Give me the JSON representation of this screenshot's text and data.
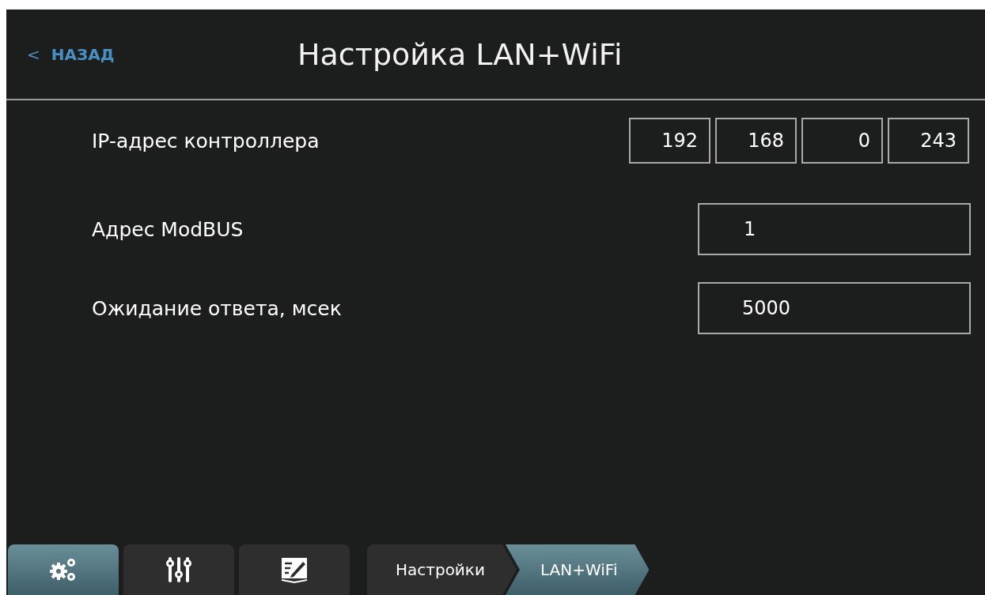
{
  "header": {
    "back": {
      "arrow": "<",
      "label": "НАЗАД"
    },
    "title": "Настройка LAN+WiFi"
  },
  "rows": [
    {
      "kind": "ip",
      "label": "IP-адрес контроллера",
      "values": [
        "192",
        "168",
        "0",
        "243"
      ]
    },
    {
      "kind": "field",
      "label": "Адрес ModBUS",
      "value": "1"
    },
    {
      "kind": "field",
      "label": "Ожидание ответа, мсек",
      "value": "5000"
    }
  ],
  "toolbar": {
    "tabs": [
      {
        "kind": "gears",
        "selected": true
      },
      {
        "kind": "sliders",
        "selected": false
      },
      {
        "kind": "book",
        "selected": false
      }
    ],
    "breadcrumb": [
      {
        "label": "Настройки",
        "selected": false
      },
      {
        "label": "LAN+WiFi",
        "selected": true
      }
    ]
  }
}
